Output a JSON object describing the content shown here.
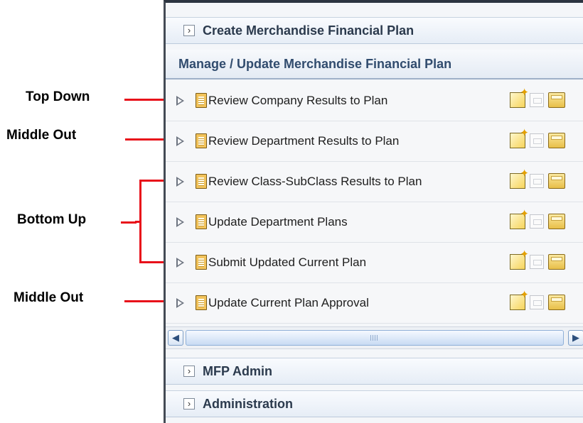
{
  "annotations": {
    "top_down": "Top Down",
    "middle_out_1": "Middle Out",
    "bottom_up": "Bottom Up",
    "middle_out_2": "Middle Out"
  },
  "accordion": {
    "create_plan": "Create Merchandise Financial Plan",
    "mfp_admin": "MFP Admin",
    "administration": "Administration"
  },
  "section": {
    "title": "Manage / Update Merchandise Financial Plan"
  },
  "tasks": [
    {
      "label": "Review Company Results to Plan"
    },
    {
      "label": "Review Department Results to Plan"
    },
    {
      "label": "Review Class-SubClass Results to Plan"
    },
    {
      "label": "Update Department Plans"
    },
    {
      "label": "Submit Updated Current Plan"
    },
    {
      "label": "Update Current Plan Approval"
    }
  ],
  "icons": [
    "chevron-right-icon",
    "expand-triangle-icon",
    "task-document-icon",
    "new-workbook-icon",
    "blank-page-icon",
    "open-folder-icon"
  ],
  "colors": {
    "annotation_line": "#e8101a",
    "section_title": "#314c6e"
  }
}
